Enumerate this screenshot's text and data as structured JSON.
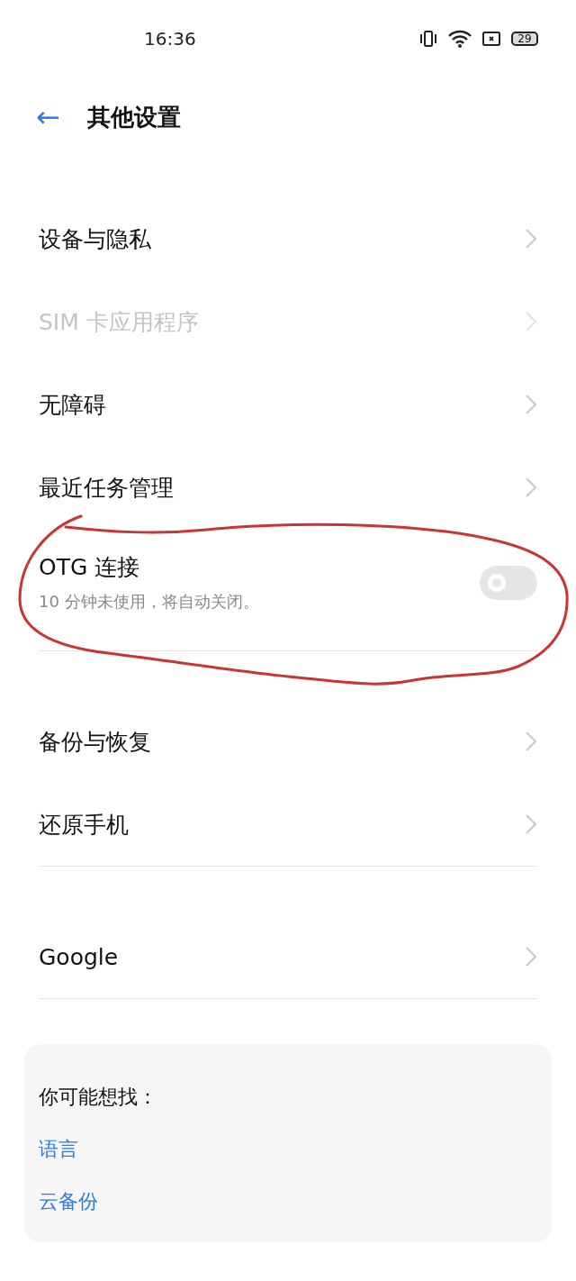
{
  "status_bar": {
    "time": "16:36",
    "battery": "29"
  },
  "header": {
    "back": "←",
    "title": "其他设置"
  },
  "groups": [
    {
      "items": [
        {
          "kind": "link",
          "label": "设备与隐私",
          "disabled": false
        },
        {
          "kind": "link",
          "label": "SIM 卡应用程序",
          "disabled": true
        },
        {
          "kind": "link",
          "label": "无障碍",
          "disabled": false
        },
        {
          "kind": "link",
          "label": "最近任务管理",
          "disabled": false
        },
        {
          "kind": "toggle",
          "label": "OTG 连接",
          "subtitle": "10 分钟未使用，将自动关闭。",
          "on": false
        }
      ]
    },
    {
      "items": [
        {
          "kind": "link",
          "label": "备份与恢复",
          "disabled": false
        },
        {
          "kind": "link",
          "label": "还原手机",
          "disabled": false
        }
      ]
    },
    {
      "items": [
        {
          "kind": "link",
          "label": "Google",
          "disabled": false
        }
      ]
    }
  ],
  "suggestions": {
    "title": "你可能想找：",
    "links": [
      "语言",
      "云备份"
    ]
  },
  "annotation": {
    "kind": "freehand-loop"
  }
}
